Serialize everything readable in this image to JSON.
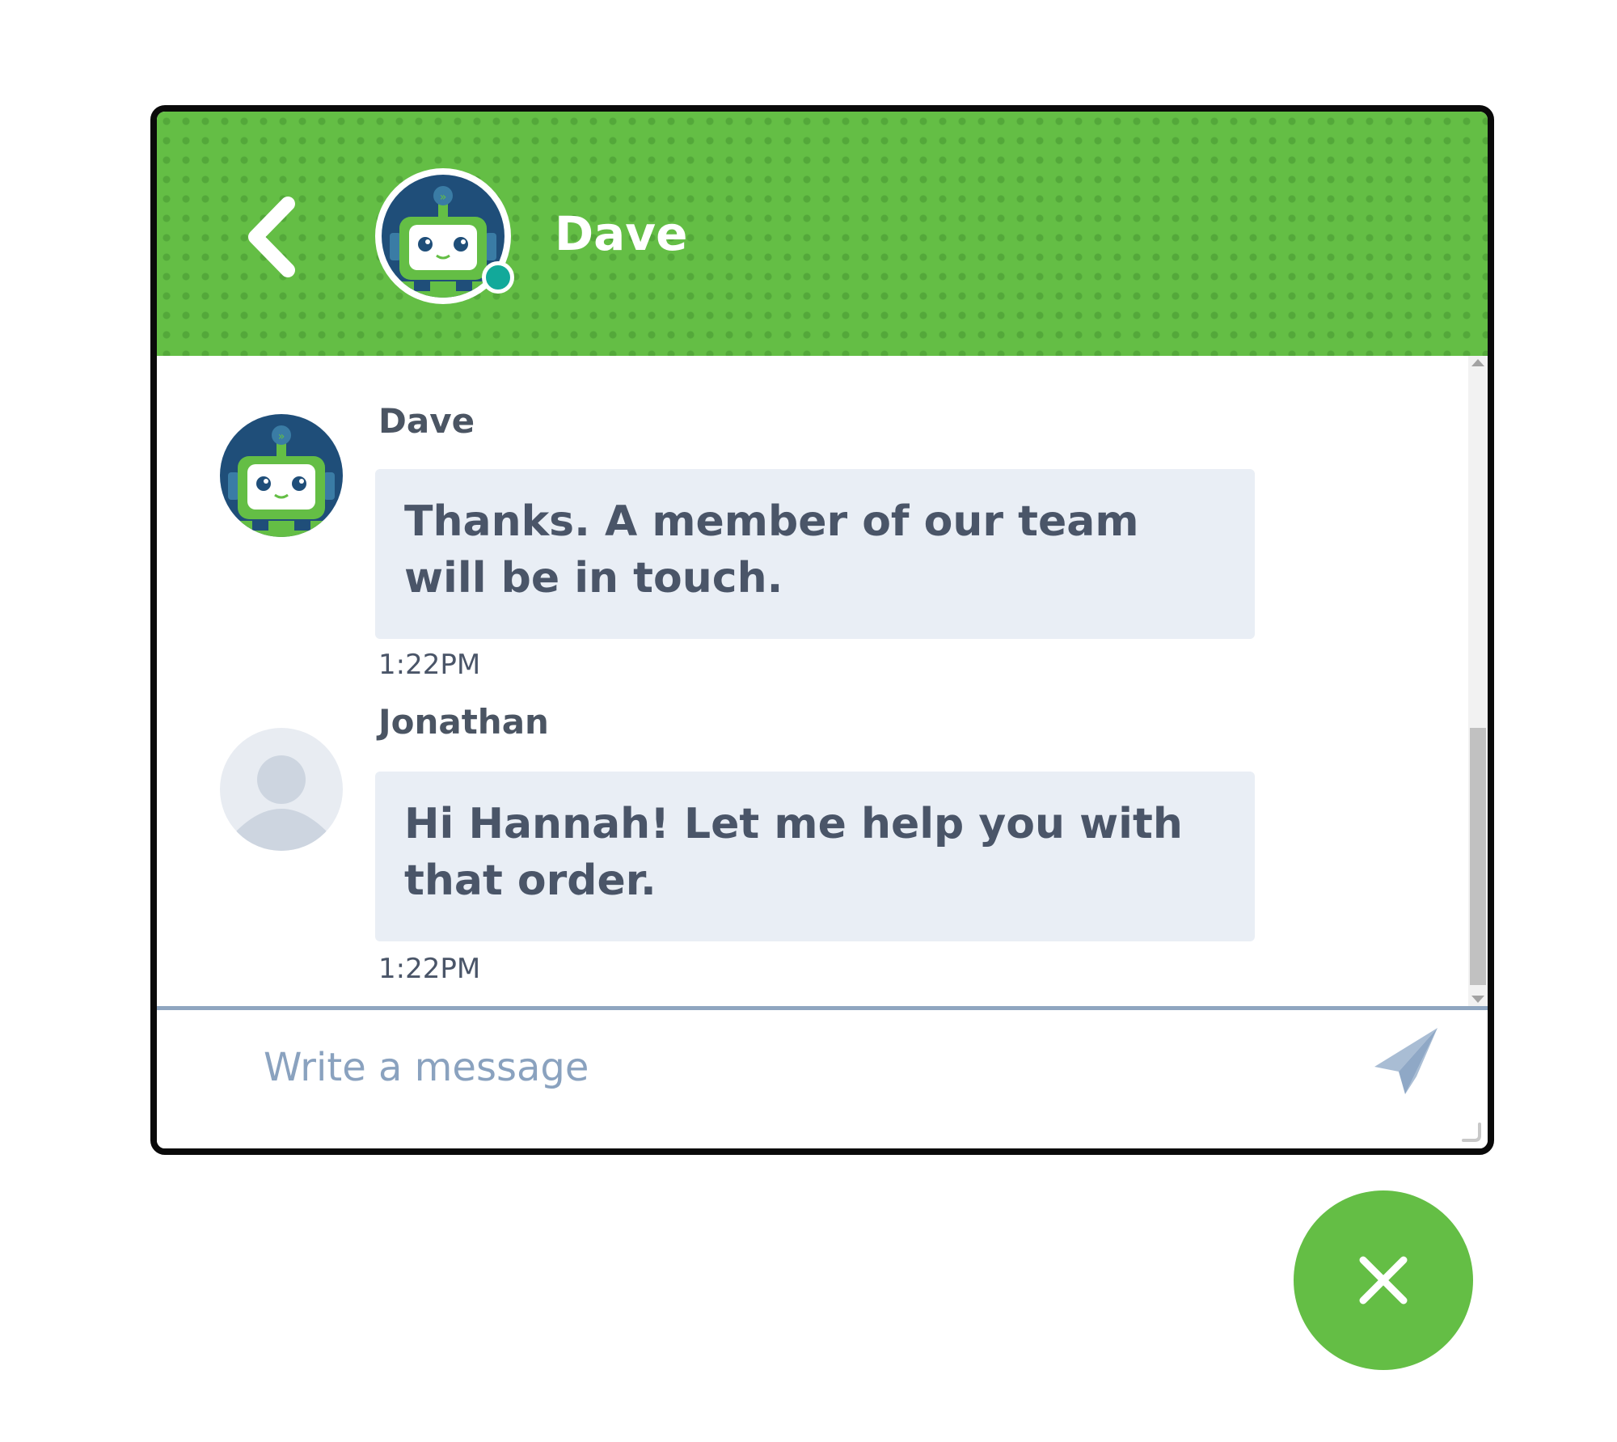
{
  "header": {
    "title": "Dave",
    "back_icon": "chevron-left-icon",
    "status": "online"
  },
  "messages": [
    {
      "sender": "Dave",
      "avatar": "robot-avatar",
      "text": "Thanks. A member of our team will be in touch.",
      "time": "1:22PM"
    },
    {
      "sender": "Jonathan",
      "avatar": "user-placeholder-avatar",
      "text": "Hi Hannah! Let me help you with that order.",
      "time": "1:22PM"
    }
  ],
  "composer": {
    "placeholder": "Write a message",
    "value": "",
    "send_icon": "paper-plane-icon"
  },
  "close_button": {
    "icon": "close-icon"
  },
  "colors": {
    "brand_green": "#64be45",
    "status_teal": "#12a99a",
    "bubble_bg": "#e9eef5",
    "text_dark": "#4a5568",
    "placeholder": "#8aa2bf"
  }
}
